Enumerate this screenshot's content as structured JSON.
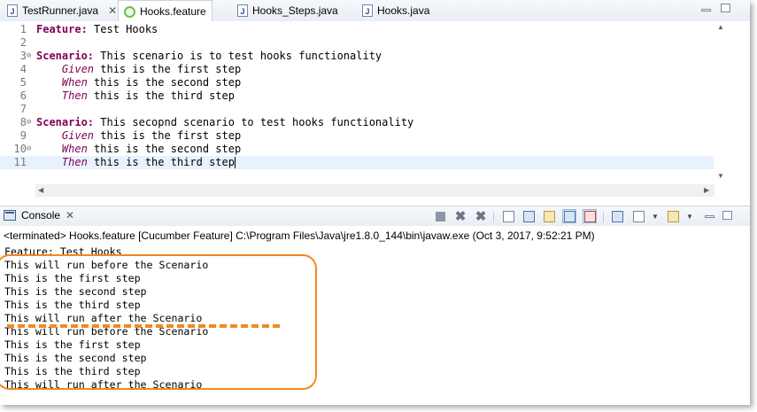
{
  "tabs": [
    {
      "label": "TestRunner.java",
      "icon": "java-file-icon",
      "active": false,
      "closable": true
    },
    {
      "label": "Hooks.feature",
      "icon": "cucumber-feature-icon",
      "active": true,
      "closable": false
    },
    {
      "label": "Hooks_Steps.java",
      "icon": "java-file-icon",
      "active": false,
      "closable": false
    },
    {
      "label": "Hooks.java",
      "icon": "java-file-icon",
      "active": false,
      "closable": false
    }
  ],
  "close_glyph": "✕",
  "editor": {
    "lines": [
      {
        "num": "1",
        "keyword": "Feature:",
        "text": " Test Hooks",
        "fold": ""
      },
      {
        "num": "2",
        "keyword": "",
        "text": "",
        "fold": ""
      },
      {
        "num": "3",
        "keyword": "Scenario:",
        "text": " This scenario is to test hooks functionality",
        "fold": "⊖"
      },
      {
        "num": "4",
        "step": "Given",
        "text": " this is the first step",
        "fold": ""
      },
      {
        "num": "5",
        "step": "When",
        "text": " this is the second step",
        "fold": ""
      },
      {
        "num": "6",
        "step": "Then",
        "text": " this is the third step",
        "fold": ""
      },
      {
        "num": "7",
        "keyword": "",
        "text": "",
        "fold": ""
      },
      {
        "num": "8",
        "keyword": "Scenario:",
        "text": " This secopnd scenario to test hooks functionality",
        "fold": "⊖"
      },
      {
        "num": "9",
        "step": "Given",
        "text": " this is the first step",
        "fold": ""
      },
      {
        "num": "10",
        "step": "When",
        "text": " this is the second step",
        "fold": "⊖"
      },
      {
        "num": "11",
        "step": "Then",
        "text": " this is the third step",
        "fold": "",
        "current": true
      }
    ]
  },
  "console": {
    "tab_label": "Console",
    "terminated": "<terminated> Hooks.feature [Cucumber Feature] C:\\Program Files\\Java\\jre1.8.0_144\\bin\\javaw.exe (Oct 3, 2017, 9:52:21 PM)",
    "output": [
      "Feature: Test Hooks",
      "This will run before the Scenario",
      "This is the first step",
      "This is the second step",
      "This is the third step",
      "This will run after the Scenario",
      "This will run before the Scenario",
      "This is the first step",
      "This is the second step",
      "This is the third step",
      "This will run after the Scenario"
    ]
  },
  "colors": {
    "accent_annotation": "#f08a1e",
    "keyword": "#7f0055",
    "current_line": "#e8f2fe"
  }
}
